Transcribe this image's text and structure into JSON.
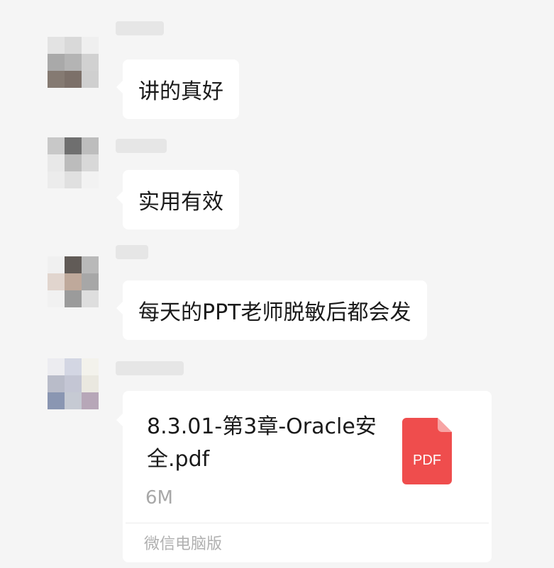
{
  "messages": [
    {
      "type": "text",
      "text": "讲的真好"
    },
    {
      "type": "text",
      "text": "实用有效"
    },
    {
      "type": "text",
      "text": "每天的PPT老师脱敏后都会发"
    },
    {
      "type": "file",
      "file_name": "8.3.01-第3章-Oracle安全.pdf",
      "file_size": "6M",
      "file_type_label": "PDF",
      "source_label": "微信电脑版"
    }
  ],
  "colors": {
    "background": "#f5f5f5",
    "bubble": "#ffffff",
    "pdf_icon": "#ef4d4d"
  },
  "icons": {
    "file": "pdf-file-icon"
  }
}
